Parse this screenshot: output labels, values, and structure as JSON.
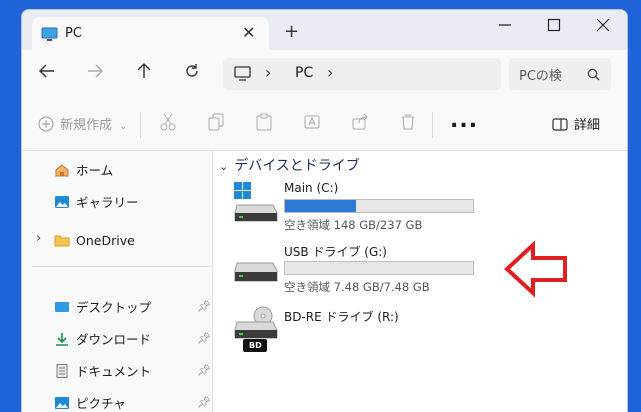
{
  "window": {
    "tab_title": "PC",
    "new_tab_symbol": "+",
    "close_tab_symbol": "✕"
  },
  "navbar": {
    "address": "PC",
    "search_placeholder": "PCの検"
  },
  "toolbar": {
    "new_label": "新規作成",
    "details_label": "詳細",
    "more_label": "..."
  },
  "sidebar": {
    "items": [
      {
        "label": "ホーム",
        "icon": "home-icon"
      },
      {
        "label": "ギャラリー",
        "icon": "gallery-icon"
      },
      {
        "label": "OneDrive",
        "icon": "folder-icon"
      },
      {
        "label": "デスクトップ",
        "icon": "desktop-icon"
      },
      {
        "label": "ダウンロード",
        "icon": "download-icon"
      },
      {
        "label": "ドキュメント",
        "icon": "document-icon"
      },
      {
        "label": "ピクチャ",
        "icon": "pictures-icon"
      }
    ]
  },
  "main": {
    "group_header": "デバイスとドライブ",
    "drives": [
      {
        "name": "Main (C:)",
        "free_text": "空き領域 148 GB/237 GB",
        "used_fraction": 0.38
      },
      {
        "name": "USB ドライブ (G:)",
        "free_text": "空き領域 7.48 GB/7.48 GB",
        "used_fraction": 0.0
      },
      {
        "name": "BD-RE ドライブ (R:)",
        "badge": "BD"
      }
    ]
  },
  "colors": {
    "accent": "#2a7ad6",
    "desktop_bg": "#1f63d8",
    "annotation_arrow": "#e02020"
  }
}
